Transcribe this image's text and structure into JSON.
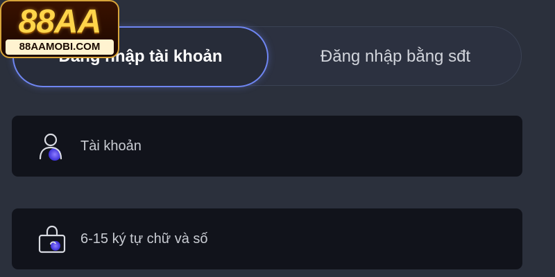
{
  "logo": {
    "main": "88AA",
    "sub": "88AAMOBI.COM"
  },
  "tabs": [
    {
      "label": "Đăng nhập tài khoản",
      "active": true
    },
    {
      "label": "Đăng nhập bằng sđt",
      "active": false
    }
  ],
  "form": {
    "username": {
      "placeholder": "Tài khoản",
      "icon": "user-icon"
    },
    "password": {
      "placeholder": "6-15 ký tự chữ và số",
      "icon": "lock-icon"
    }
  },
  "colors": {
    "background": "#2b303c",
    "field_bg": "#11131b",
    "accent": "#6f86f2",
    "logo_gold": "#ffd54a"
  }
}
